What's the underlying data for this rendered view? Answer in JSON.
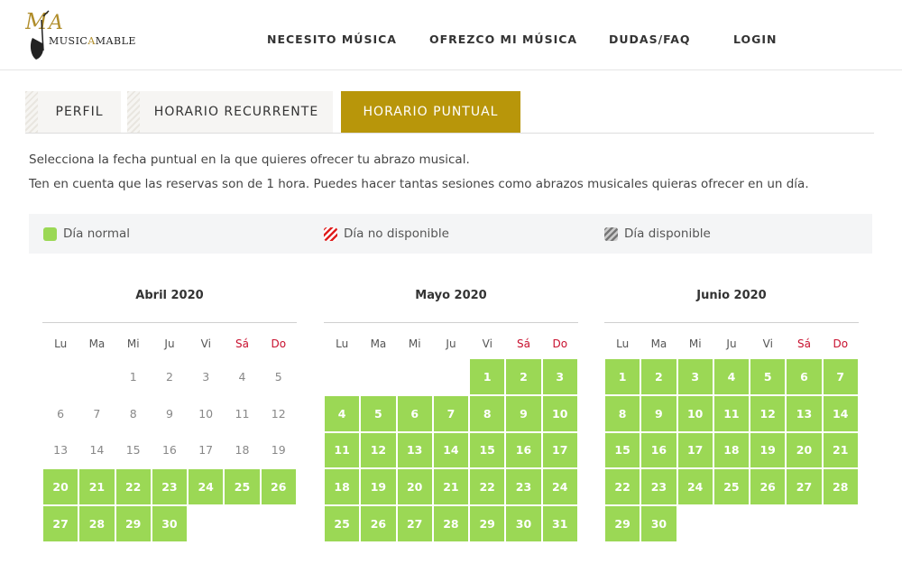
{
  "brand": {
    "monogram": "MA",
    "name_pre": "MUSIC",
    "name_accent": "A",
    "name_post": "MABLE"
  },
  "nav": [
    "NECESITO MÚSICA",
    "OFREZCO MI MÚSICA",
    "DUDAS/FAQ",
    "LOGIN"
  ],
  "tabs": [
    {
      "label": "PERFIL",
      "active": false
    },
    {
      "label": "HORARIO RECURRENTE",
      "active": false
    },
    {
      "label": "HORARIO PUNTUAL",
      "active": true
    }
  ],
  "description": [
    "Selecciona la fecha puntual en la que quieres ofrecer tu abrazo musical.",
    "Ten en cuenta que las reservas son de 1 hora. Puedes hacer tantas sesiones como abrazos musicales quieras ofrecer en un día."
  ],
  "legend": [
    {
      "label": "Día normal",
      "type": "normal"
    },
    {
      "label": "Día no disponible",
      "type": "unavailable"
    },
    {
      "label": "Día disponible",
      "type": "available"
    }
  ],
  "weekdays": [
    "Lu",
    "Ma",
    "Mi",
    "Ju",
    "Vi",
    "Sá",
    "Do"
  ],
  "colors": {
    "accent": "#b8960a",
    "normal_day": "#9bd855",
    "weekend": "#c8102e"
  },
  "calendars": [
    {
      "title": "Abril 2020",
      "offset": 2,
      "days": 30,
      "first_normal": 20
    },
    {
      "title": "Mayo 2020",
      "offset": 4,
      "days": 31,
      "first_normal": 1
    },
    {
      "title": "Junio 2020",
      "offset": 0,
      "days": 30,
      "first_normal": 1
    }
  ]
}
